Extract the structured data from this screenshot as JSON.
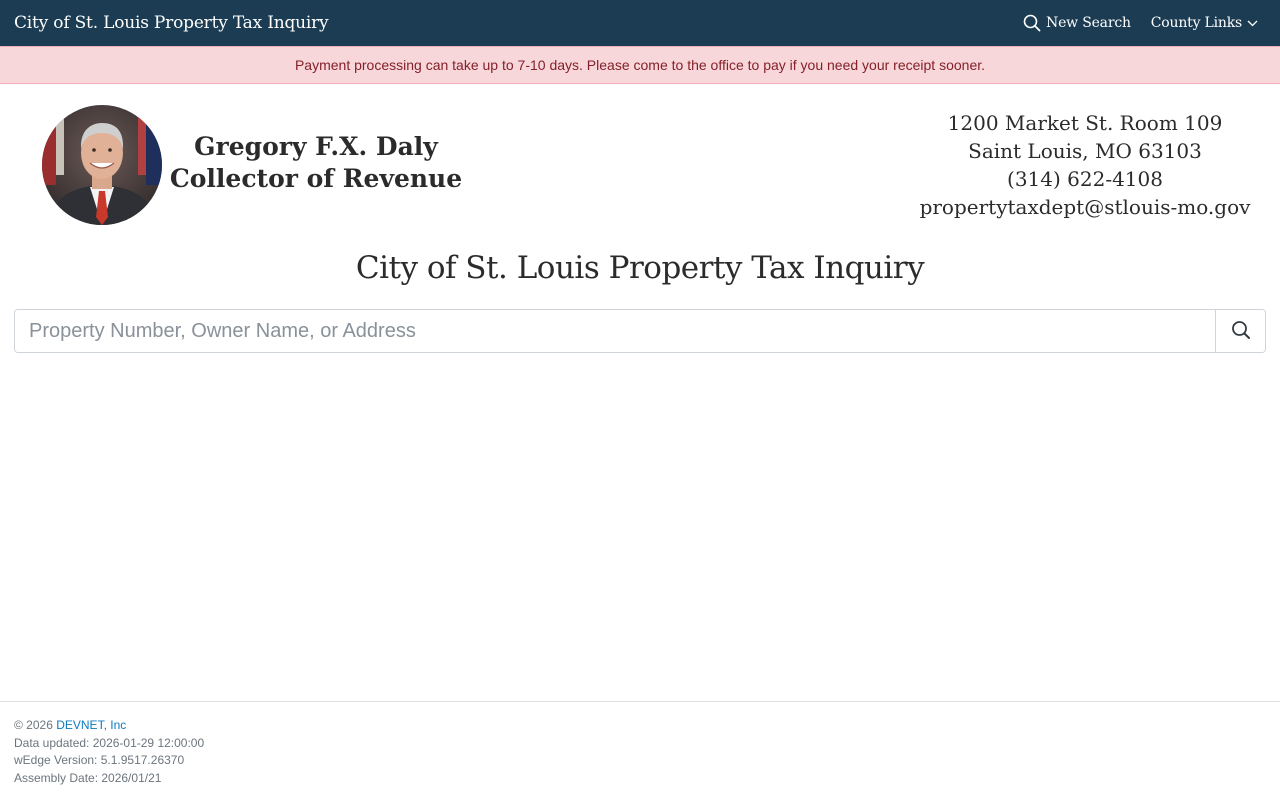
{
  "nav": {
    "brand": "City of St. Louis Property Tax Inquiry",
    "new_search": "New Search",
    "county_links": "County Links"
  },
  "alert": {
    "message": "Payment processing can take up to 7-10 days. Please come to the office to pay if you need your receipt sooner."
  },
  "collector": {
    "name": "Gregory F.X. Daly",
    "title": "Collector of Revenue"
  },
  "contact": {
    "address1": "1200 Market St. Room 109",
    "address2": "Saint Louis, MO 63103",
    "phone": "(314) 622-4108",
    "email": "propertytaxdept@stlouis-mo.gov"
  },
  "page_title": "City of St. Louis Property Tax Inquiry",
  "search": {
    "placeholder": "Property Number, Owner Name, or Address",
    "value": ""
  },
  "footer": {
    "copyright_prefix": "© 2026",
    "company_link": "DEVNET, Inc",
    "data_updated": "Data updated: 2026-01-29 12:00:00",
    "version": "wEdge Version: 5.1.9517.26370",
    "assembly_date": "Assembly Date: 2026/01/21"
  },
  "colors": {
    "navbar_bg": "#1b3c52",
    "alert_bg": "#f8d7da",
    "alert_text": "#842029",
    "link": "#0d7ac1"
  },
  "icons": {
    "new_search": "search-icon",
    "county_links": "chevron-down-icon",
    "search_button": "search-icon"
  }
}
